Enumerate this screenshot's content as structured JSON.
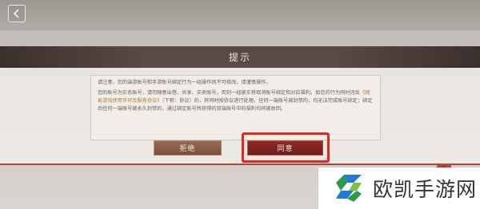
{
  "dialog": {
    "title": "提示",
    "paragraph1": "请注意，您的端游账号和手游账号绑定行为一经操作则不可修改，请谨慎操作。",
    "paragraph2_before": "您的账号为实名账号，请勿随意出借、共享、买卖账号，否则一经被实将取消账号绑定和对应福利。如您的行为同时违反",
    "paragraph2_link": "《网易游戏使用许可及服务协议》",
    "paragraph2_after": "（下称：协议）的，将同时按协议进行处理。任何一端账号被封禁的，均无法完成账号绑定；绑定后任何一端账号被永久封禁的，通过绑定账号所获得的双端账号中的福利均将被收回。",
    "refuse_label": "拒绝",
    "agree_label": "同意"
  },
  "watermark": {
    "text": "欧凯手游网"
  },
  "colors": {
    "highlight": "#e8261f",
    "agree_button": "#8f2a27",
    "refuse_button": "#9a6a54",
    "link": "#b5783a"
  }
}
